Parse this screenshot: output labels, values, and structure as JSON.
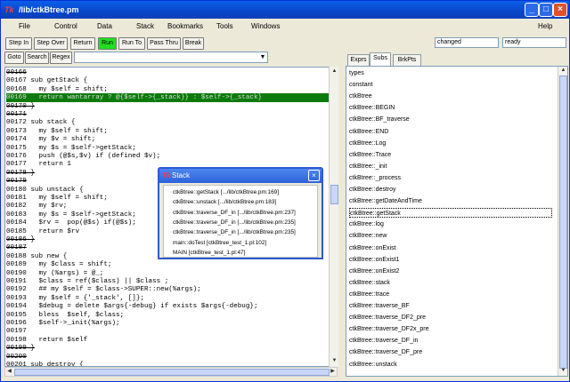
{
  "window": {
    "title": "/lib/ctkBtree.pm"
  },
  "menu": [
    "File",
    "Control",
    "Data",
    "Stack",
    "Bookmarks",
    "Tools",
    "Windows",
    "Help"
  ],
  "toolbar": {
    "buttons": [
      "Step In",
      "Step Over",
      "Return",
      "Run",
      "Run To",
      "Pass Thru",
      "Break"
    ],
    "active_button": "Run",
    "active_color": "#1ee01e",
    "status_1": "changed",
    "status_2": "ready"
  },
  "search": {
    "buttons": [
      "Goto",
      "Search",
      "Regex"
    ],
    "value": ""
  },
  "code": {
    "highlight_color": "#0c7a0c",
    "lines": [
      {
        "text": "00166",
        "breakpoint": true
      },
      {
        "text": "00167 sub getStack {"
      },
      {
        "text": "00168   my $self = shift;"
      },
      {
        "text": "00169   return wantarray ? @{$self->{_stack}} : $self->{_stack}",
        "highlight": true
      },
      {
        "text": "00170 }",
        "breakpoint": true
      },
      {
        "text": "00171",
        "breakpoint": true
      },
      {
        "text": "00172 sub stack {"
      },
      {
        "text": "00173   my $self = shift;"
      },
      {
        "text": "00174   my $v = shift;"
      },
      {
        "text": "00175   my $s = $self->getStack;"
      },
      {
        "text": "00176   push (@$s,$v) if (defined $v);"
      },
      {
        "text": "00177   return 1"
      },
      {
        "text": "00178 }",
        "breakpoint": true
      },
      {
        "text": "00179",
        "breakpoint": true
      },
      {
        "text": "00180 sub unstack {"
      },
      {
        "text": "00181   my $self = shift;"
      },
      {
        "text": "00182   my $rv;"
      },
      {
        "text": "00183   my $s = $self->getStack;"
      },
      {
        "text": "00184   $rv =  pop(@$s) if(@$s);"
      },
      {
        "text": "00185   return $rv"
      },
      {
        "text": "00186 }",
        "breakpoint": true
      },
      {
        "text": "00187",
        "breakpoint": true
      },
      {
        "text": "00188 sub new {"
      },
      {
        "text": "00189   my $class = shift;"
      },
      {
        "text": "00190   my (%args) = @_;"
      },
      {
        "text": "00191   $class = ref($class) || $class ;"
      },
      {
        "text": "00192   ## my $self = $class->SUPER::new(%args);"
      },
      {
        "text": "00193   my $self = {'_stack', []};"
      },
      {
        "text": "00194   $debug = delete $args{-debug} if exists $args{-debug};"
      },
      {
        "text": "00195   bless  $self, $class;"
      },
      {
        "text": "00196   $self->_init(%args);"
      },
      {
        "text": "00197"
      },
      {
        "text": "00198   return $self"
      },
      {
        "text": "00199 }",
        "breakpoint": true
      },
      {
        "text": "00200",
        "breakpoint": true
      },
      {
        "text": "00201 sub destroy {"
      }
    ]
  },
  "tabs": [
    "Exprs",
    "Subs",
    "BrkPts"
  ],
  "selected_tab": "Subs",
  "subs": [
    "types",
    "constant",
    "ctkBtree",
    "ctkBtree::BEGIN",
    "ctkBtree::BF_traverse",
    "ctkBtree::END",
    "ctkBtree::Log",
    "ctkBtree::Trace",
    "ctkBtree::_init",
    "ctkBtree::_process",
    "ctkBtree::destroy",
    "ctkBtree::getDateAndTime",
    "ctkBtree::getStack",
    "ctkBtree::log",
    "ctkBtree::new",
    "ctkBtree::onExist",
    "ctkBtree::onExist1",
    "ctkBtree::onExist2",
    "ctkBtree::stack",
    "ctkBtree::trace",
    "ctkBtree::traverse_BF",
    "ctkBtree::traverse_DF2_pre",
    "ctkBtree::traverse_DF2x_pre",
    "ctkBtree::traverse_DF_in",
    "ctkBtree::traverse_DF_pre",
    "ctkBtree::unstack"
  ],
  "focused_sub": "ctkBtree::getStack",
  "stack_window": {
    "title": "Stack",
    "items": [
      "ctkBtree::getStack [.../lib/ctkBtree.pm:169]",
      "ctkBtree::unstack [.../lib/ctkBtree.pm:183]",
      "ctkBtree::traverse_DF_in [.../lib/ctkBtree.pm:237]",
      "ctkBtree::traverse_DF_in [.../lib/ctkBtree.pm:235]",
      "ctkBtree::traverse_DF_in [.../lib/ctkBtree.pm:235]",
      "main::doTest [ctkBtree_test_1.pl:102]",
      "MAIN [ctkBtree_test_1.pl:47]"
    ]
  }
}
